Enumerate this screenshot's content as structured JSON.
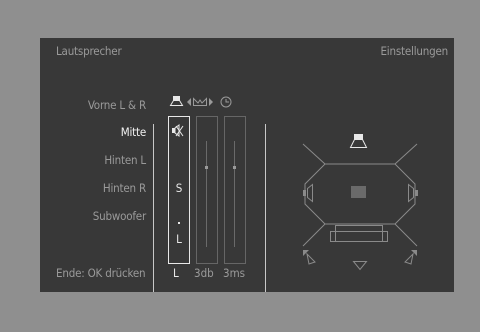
{
  "header": {
    "title": "Lautsprecher",
    "settings": "Einstellungen"
  },
  "menu": {
    "items": [
      {
        "label": "Vorne L & R"
      },
      {
        "label": "Mitte"
      },
      {
        "label": "Hinten L"
      },
      {
        "label": "Hinten R"
      },
      {
        "label": "Subwoofer"
      }
    ],
    "selected": "Mitte"
  },
  "footer": {
    "hint": "Ende: OK drücken"
  },
  "columns": {
    "icons": [
      "speaker-icon",
      "level-arrows-icon",
      "delay-clock-icon"
    ],
    "mute_icon": "speaker-mute-icon",
    "size_label": "S",
    "position_label": "L",
    "values": {
      "position": "L",
      "level": "3db",
      "delay": "3ms"
    }
  },
  "colors": {
    "background": "#383838",
    "text": "#9a9a9a",
    "highlight": "#f2f2f2",
    "frame": "#8f8f8f"
  }
}
